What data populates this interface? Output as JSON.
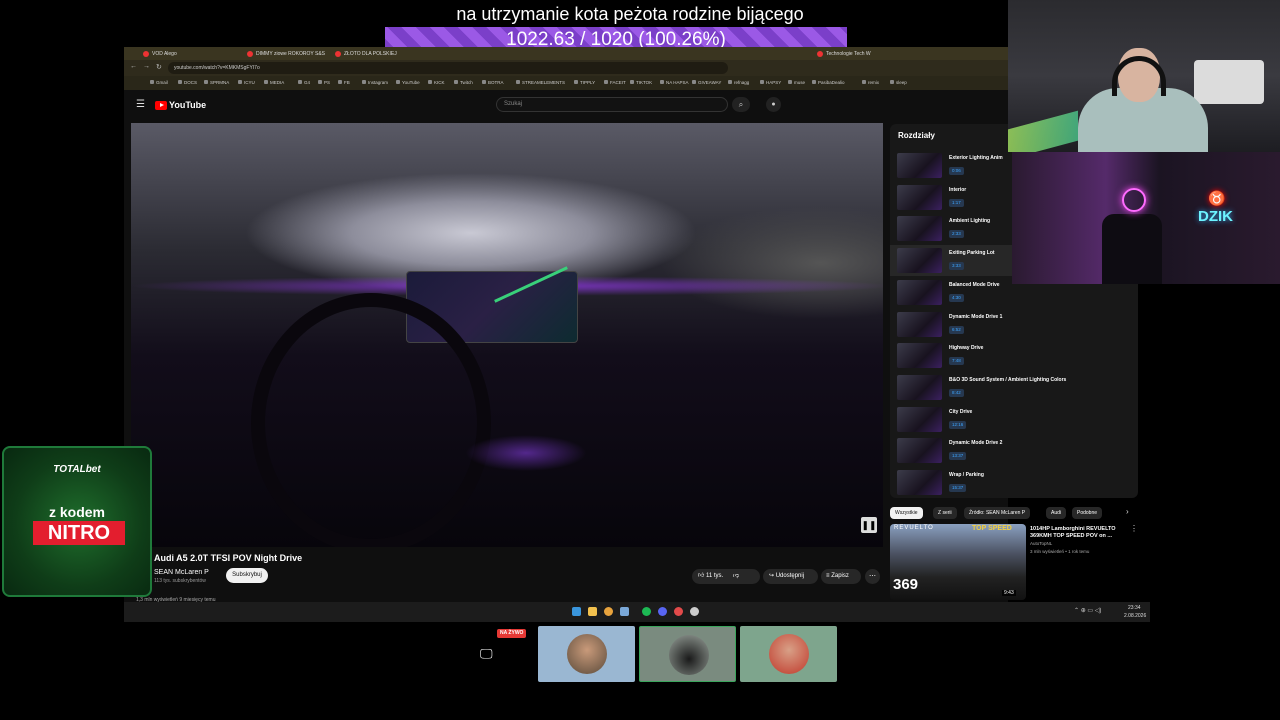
{
  "overlay": {
    "goal_title": "na utrzymanie kota peżota rodzine bijącego",
    "goal_progress": "1022.63 / 1020 (100.26%)",
    "goal_fraction": 1.0026
  },
  "browser": {
    "tabs": [
      "VOD Alego",
      "DIMMY ziowe ROKOROY S&S",
      "ZŁOTO DLA POLSKIEJ",
      "Technologie Tech W"
    ],
    "url": "youtube.com/watch?v=KMKMSgFYI7o",
    "bookmarks": [
      "Gmail",
      "DOCS",
      "SPRMNA",
      "ICYU",
      "MEDIA",
      "G4",
      "PS",
      "FB",
      "Instagram",
      "YouTube",
      "KICK",
      "Twitch",
      "BOTRA",
      "STREAMELEMENTS",
      "TIPPLY",
      "FACEIT",
      "TIKTOK",
      "NA HAPSA",
      "GIVEAWAY",
      "refnagg",
      "HAPSY",
      "muse",
      "PasibaDealio",
      "remix",
      "sleep"
    ]
  },
  "youtube": {
    "logo_text": "YouTube",
    "search_placeholder": "Szukaj",
    "video": {
      "title": "Audi A5 2.0T TFSI POV Night Drive",
      "channel": "SEAN McLaren P",
      "subscribers": "113 tys. subskrybentów",
      "subscribe_label": "Subskrybuj",
      "likes": "11 tys.",
      "share_label": "Udostępnij",
      "save_label": "Zapisz",
      "views_line": "1,3 mln wyświetleń  9 miesięcy temu"
    },
    "chapters": {
      "title": "Rozdziały",
      "items": [
        {
          "title": "Exterior Lighting Anim",
          "time": "0:06"
        },
        {
          "title": "Interior",
          "time": "1:17"
        },
        {
          "title": "Ambient Lighting",
          "time": "2:33"
        },
        {
          "title": "Exiting Parking Lot",
          "time": "3:33"
        },
        {
          "title": "Balanced Mode Drive",
          "time": "4:30"
        },
        {
          "title": "Dynamic Mode Drive 1",
          "time": "6:52"
        },
        {
          "title": "Highway Drive",
          "time": "7:48"
        },
        {
          "title": "B&O 3D Sound System / Ambient Lighting Colors",
          "time": "8:42"
        },
        {
          "title": "City Drive",
          "time": "12:16"
        },
        {
          "title": "Dynamic Mode Drive 2",
          "time": "13:37"
        },
        {
          "title": "Wrap / Parking",
          "time": "15:37"
        }
      ],
      "active_index": 3
    },
    "chips": [
      "Wszystkie",
      "Z serii",
      "Źródło: SEAN McLaren P",
      "Audi",
      "Podobne"
    ],
    "recommendation": {
      "title": "1014HP Lamborghini REVUELTO 369KMH TOP SPEED POV on ...",
      "channel": "AutoTopNL",
      "meta": "3 mln wyświetleń • 1 rok temu",
      "duration": "9:43",
      "thumb_brand": "REVUELTO",
      "thumb_topspeed": "TOP SPEED",
      "thumb_speed": "369"
    }
  },
  "taskbar": {
    "time": "23:34",
    "date": "2.08.2026"
  },
  "webcam": {
    "neon_text": "DZIK"
  },
  "sponsor": {
    "brand": "TOTALbet",
    "line1": "z kodem",
    "code": "NITRO"
  },
  "call": {
    "live_badge": "NA ŻYWO"
  },
  "colors": {
    "goal_bar": "#9b59e6",
    "youtube_red": "#ff0000",
    "sponsor_green": "#1f6e2c",
    "sponsor_red": "#e31e2e",
    "chapter_time_blue": "#3ea6ff"
  }
}
